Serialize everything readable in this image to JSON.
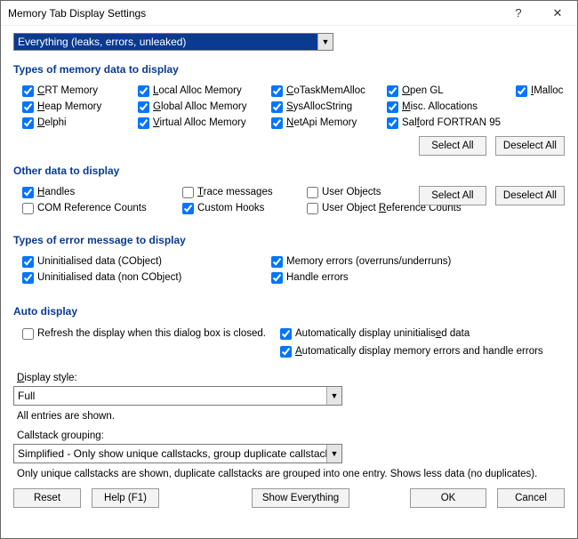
{
  "window": {
    "title": "Memory Tab Display Settings"
  },
  "filter": {
    "selected": "Everything (leaks, errors, unleaked)"
  },
  "sections": {
    "memory": "Types of memory data to display",
    "other": "Other data to display",
    "errors": "Types of error message to display",
    "auto": "Auto display"
  },
  "mem": {
    "crt_p": "C",
    "crt_s": "RT Memory",
    "heap_p": "H",
    "heap_s": "eap Memory",
    "delphi_p": "D",
    "delphi_s": "elphi",
    "local_p": "L",
    "local_s": "ocal Alloc Memory",
    "global_p": "G",
    "global_s": "lobal Alloc Memory",
    "virtual_p": "V",
    "virtual_s": "irtual Alloc Memory",
    "cotask_p": "C",
    "cotask_s": "oTaskMemAlloc",
    "sysalloc_p": "S",
    "sysalloc_s": "ysAllocString",
    "netapi_p": "N",
    "netapi_s": "etApi Memory",
    "opengl_p": "O",
    "opengl_s": "pen GL",
    "miscalloc_p": "M",
    "miscalloc_s": "isc. Allocations",
    "salford_pre": "Sal",
    "salford_u": "f",
    "salford_post": "ord FORTRAN 95",
    "imalloc_p": "I",
    "imalloc_s": "Malloc"
  },
  "other": {
    "handles_p": "H",
    "handles_s": "andles",
    "comref": "COM Reference Counts",
    "trace_p": "T",
    "trace_s": "race messages",
    "custom_s": "Custom Hooks",
    "userobj": "User Objects",
    "userref_pre": "User Object ",
    "userref_u": "R",
    "userref_post": "eference Counts"
  },
  "err": {
    "uninit_cobj": "Uninitialised data (CObject)",
    "uninit_non": "Uninitialised data (non CObject)",
    "memerr": "Memory errors (overruns/underruns)",
    "handleerr": "Handle errors"
  },
  "auto": {
    "refresh": "Refresh the display when this dialog box is closed.",
    "auto_uninit_pre": "Automatically display uninitialis",
    "auto_uninit_u": "e",
    "auto_uninit_post": "d data",
    "auto_memerr_p": "A",
    "auto_memerr_s": "utomatically display memory errors and handle errors"
  },
  "display_style": {
    "label_p": "D",
    "label_s": "isplay style:",
    "value": "Full",
    "help": "All entries are shown."
  },
  "callstack": {
    "label": "Callstack grouping:",
    "value": "Simplified - Only show unique callstacks, group duplicate callstacks",
    "help": "Only unique callstacks are shown, duplicate callstacks are grouped into one entry. Shows less data (no duplicates)."
  },
  "buttons": {
    "select_all": "Select All",
    "deselect_all": "Deselect All",
    "reset": "Reset",
    "help": "Help (F1)",
    "show_everything": "Show Everything",
    "ok": "OK",
    "cancel": "Cancel"
  }
}
